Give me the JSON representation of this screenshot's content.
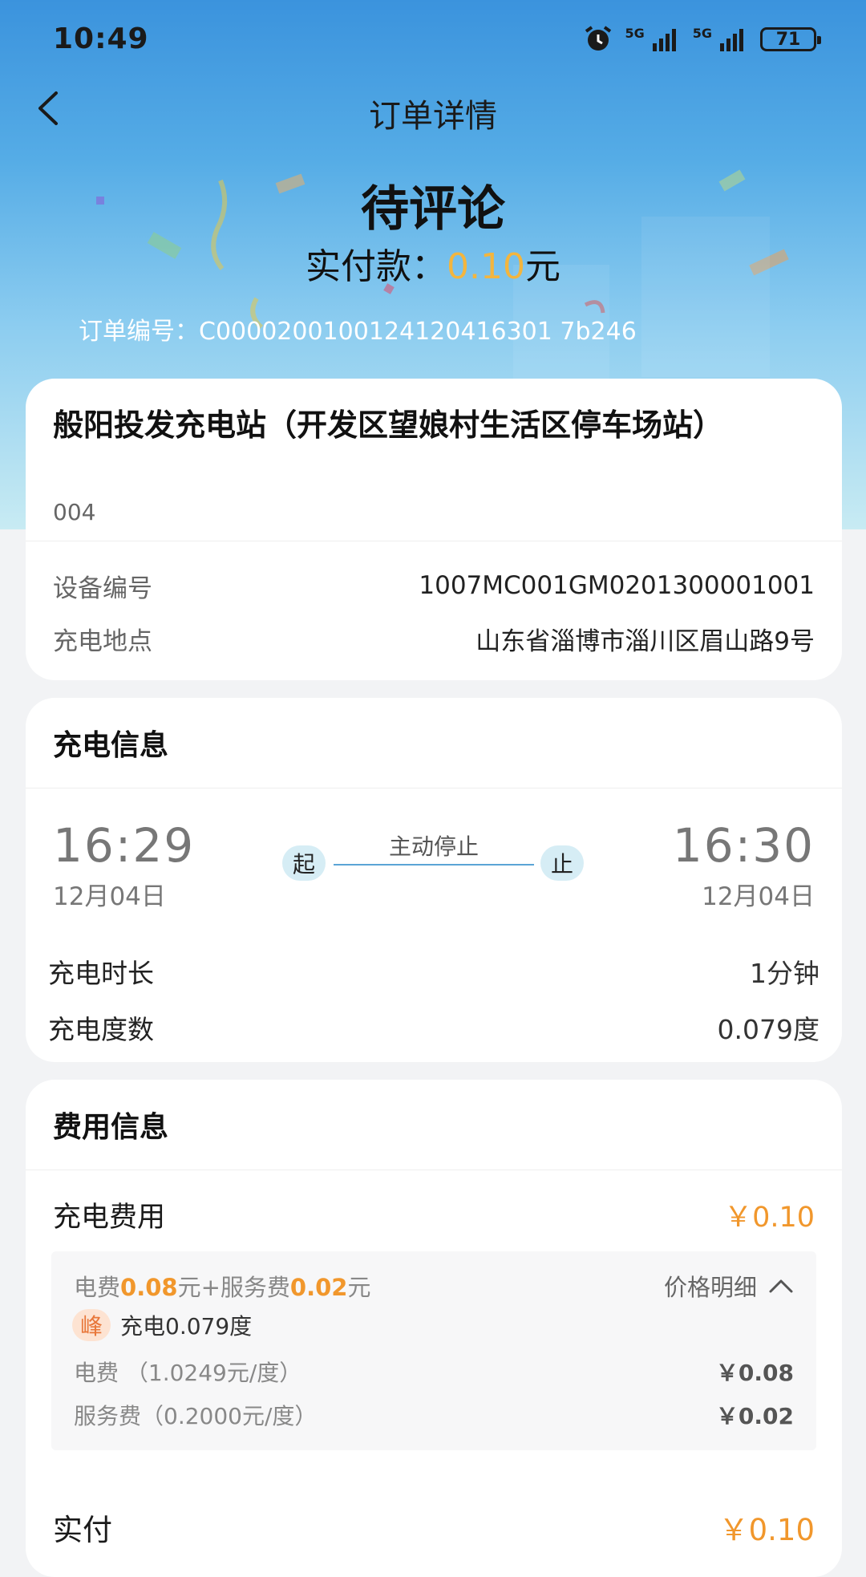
{
  "status_bar": {
    "time": "10:49",
    "signal_1_label": "5G",
    "signal_2_label": "5G",
    "battery": "71"
  },
  "header": {
    "title": "订单详情",
    "status": "待评论",
    "paid_prefix": "实付款：",
    "paid_amount": "0.10",
    "paid_unit": "元",
    "order_number": "订单编号：C0000200100124120416301 7b246"
  },
  "station": {
    "name": "般阳投发充电站（开发区望娘村生活区停车场站）",
    "sub": "004",
    "device_label": "设备编号",
    "device_value": "1007MC001GM0201300001001",
    "location_label": "充电地点",
    "location_value": "山东省淄博市淄川区眉山路9号"
  },
  "charging": {
    "title": "充电信息",
    "start_time": "16:29",
    "start_date": "12月04日",
    "start_badge": "起",
    "stop_reason": "主动停止",
    "end_badge": "止",
    "end_time": "16:30",
    "end_date": "12月04日",
    "duration_label": "充电时长",
    "duration_value": "1分钟",
    "energy_label": "充电度数",
    "energy_value": "0.079度"
  },
  "fees": {
    "title": "费用信息",
    "charge_fee_label": "充电费用",
    "charge_fee_value": "￥0.10",
    "elec_label": "电费",
    "elec_amount": "0.08",
    "yuan_plus_service": "元+服务费",
    "service_amount": "0.02",
    "yuan": "元",
    "price_detail": "价格明细",
    "peak_tag": "峰",
    "peak_text": "充电0.079度",
    "elec_rate_label": "电费 （1.0249元/度）",
    "elec_rate_value": "￥0.08",
    "service_rate_label": "服务费（0.2000元/度）",
    "service_rate_value": "￥0.02",
    "paid_label": "实付",
    "paid_value": "￥0.10"
  },
  "colors": {
    "accent_orange": "#f1972c",
    "paid_yellow": "#f3b53e",
    "header_blue": "#3b93dd"
  }
}
